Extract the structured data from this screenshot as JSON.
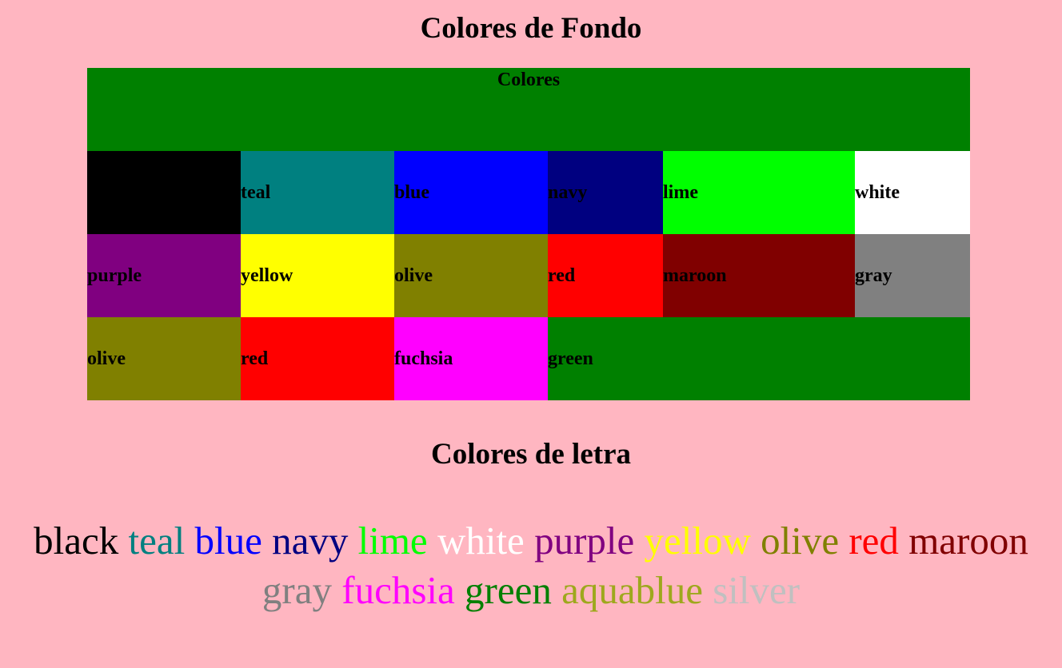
{
  "headings": {
    "background": "Colores de Fondo",
    "text": "Colores de letra"
  },
  "table": {
    "header": "Colores",
    "header_color": "#008000",
    "rows": [
      [
        {
          "label": "",
          "color": "#000000"
        },
        {
          "label": "teal",
          "color": "#008080"
        },
        {
          "label": "blue",
          "color": "#0000ff"
        },
        {
          "label": "navy",
          "color": "#000080"
        },
        {
          "label": "lime",
          "color": "#00ff00"
        },
        {
          "label": "white",
          "color": "#ffffff"
        }
      ],
      [
        {
          "label": "purple",
          "color": "#800080"
        },
        {
          "label": "yellow",
          "color": "#ffff00"
        },
        {
          "label": "olive",
          "color": "#808000"
        },
        {
          "label": "red",
          "color": "#ff0000"
        },
        {
          "label": "maroon",
          "color": "#800000"
        },
        {
          "label": "gray",
          "color": "#808080"
        }
      ],
      [
        {
          "label": "olive",
          "color": "#808000"
        },
        {
          "label": "red",
          "color": "#ff0000"
        },
        {
          "label": "fuchsia",
          "color": "#ff00ff"
        },
        {
          "label": "green",
          "color": "#008000",
          "span": 3
        }
      ]
    ]
  },
  "font_colors": [
    {
      "word": "black",
      "color": "#000000"
    },
    {
      "word": "teal",
      "color": "#008080"
    },
    {
      "word": "blue",
      "color": "#0000ff"
    },
    {
      "word": "navy",
      "color": "#000080"
    },
    {
      "word": "lime",
      "color": "#00ff00"
    },
    {
      "word": "white",
      "color": "#ffffff"
    },
    {
      "word": "purple",
      "color": "#800080"
    },
    {
      "word": "yellow",
      "color": "#ffff00"
    },
    {
      "word": "olive",
      "color": "#808000"
    },
    {
      "word": "red",
      "color": "#ff0000"
    },
    {
      "word": "maroon",
      "color": "#800000"
    },
    {
      "word": "gray",
      "color": "#808080"
    },
    {
      "word": "fuchsia",
      "color": "#ff00ff"
    },
    {
      "word": "green",
      "color": "#008000"
    },
    {
      "word": "aquablue",
      "color": "#9ea81d"
    },
    {
      "word": "silver",
      "color": "#c0c0c0"
    }
  ]
}
